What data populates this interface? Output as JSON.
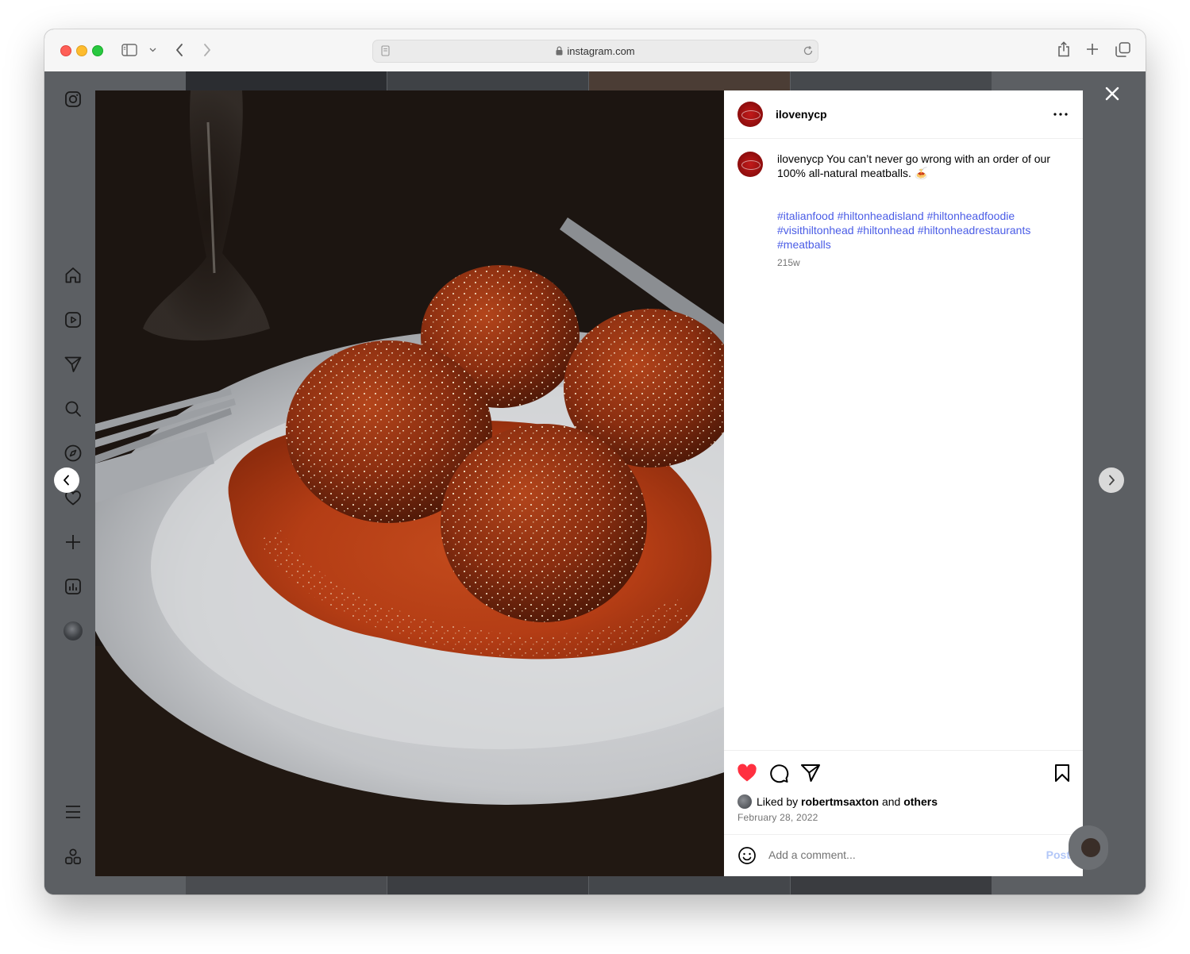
{
  "browser": {
    "url": "instagram.com"
  },
  "post": {
    "username": "ilovenycp",
    "caption_user": "ilovenycp",
    "caption_text": "You can’t never go wrong with an order of our 100% all-natural meatballs. 🍝",
    "hashtags": [
      "#italianfood",
      "#hiltonheadisland",
      "#hiltonheadfoodie",
      "#visithiltonhead",
      "#hiltonhead",
      "#hiltonheadrestaurants",
      "#meatballs"
    ],
    "age": "215w",
    "liked_prefix": "Liked by",
    "liked_user": "robertmsaxton",
    "liked_and": "and",
    "liked_others": "others",
    "date": "February 28, 2022",
    "liked": true
  },
  "comment": {
    "placeholder": "Add a comment...",
    "post_label": "Post"
  },
  "icons": {
    "sidebar": [
      "instagram-logo-icon",
      "home-icon",
      "reels-icon",
      "messages-icon",
      "search-icon",
      "explore-icon",
      "notifications-icon",
      "create-icon",
      "dashboard-icon",
      "profile-avatar",
      "more-menu-icon",
      "also-from-meta-icon"
    ],
    "actions": [
      "heart-icon",
      "comment-icon",
      "share-icon",
      "bookmark-icon"
    ]
  },
  "colors": {
    "heart": "#ff3040",
    "hashtag": "#4a5ce6",
    "post_button": "#b2c7f8",
    "overlay": "#5c5f63"
  }
}
